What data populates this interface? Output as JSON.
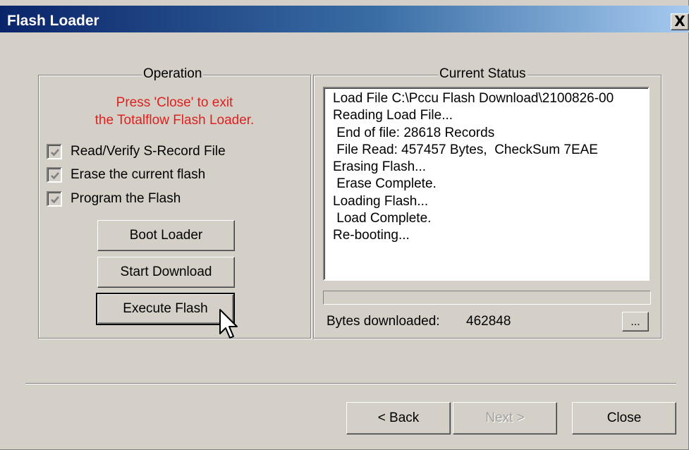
{
  "window": {
    "title": "Flash Loader",
    "close_glyph": "X"
  },
  "operation": {
    "legend": "Operation",
    "notice_line1": "Press 'Close' to exit",
    "notice_line2": "the Totalflow Flash Loader.",
    "notice_color": "#e02020",
    "checkboxes": [
      {
        "label": "Read/Verify S-Record File",
        "checked": true
      },
      {
        "label": "Erase the current flash",
        "checked": true
      },
      {
        "label": "Program the Flash",
        "checked": true
      }
    ],
    "buttons": {
      "boot_loader": "Boot Loader",
      "start_download": "Start Download",
      "execute_flash": "Execute Flash"
    }
  },
  "status": {
    "legend": "Current Status",
    "lines": [
      "Load File C:\\Pccu Flash Download\\2100826-00",
      "Reading Load File...",
      " End of file: 28618 Records",
      " File Read: 457457 Bytes,  CheckSum 7EAE",
      "Erasing Flash...",
      " Erase Complete.",
      "Loading Flash...",
      " Load Complete.",
      "Re-booting..."
    ],
    "progress_fraction": 0,
    "bytes_label": "Bytes downloaded:",
    "bytes_value": "462848",
    "browse_label": "..."
  },
  "footer": {
    "back_label": "< Back",
    "next_label": "Next >",
    "close_label": "Close"
  },
  "colors": {
    "title_gradient_start": "#0a246a",
    "title_gradient_end": "#a6caf0",
    "face": "#d4d0c8"
  },
  "icons": {
    "cursor": "arrow-pointer-icon",
    "check": "checkmark-icon"
  }
}
